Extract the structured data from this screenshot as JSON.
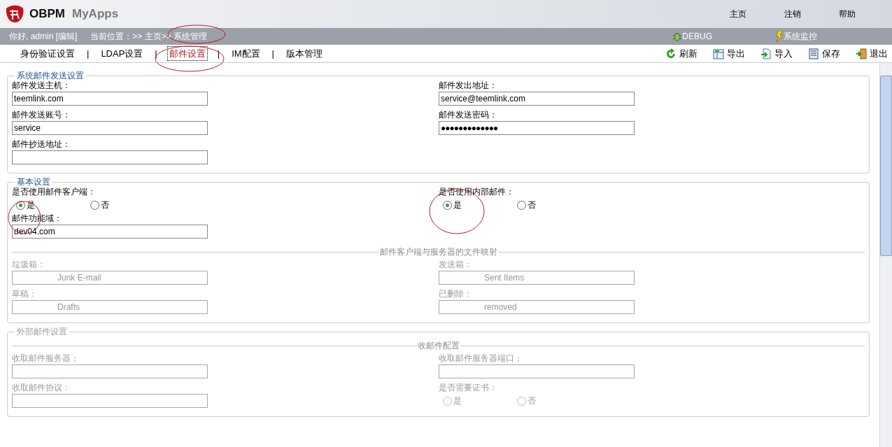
{
  "header": {
    "logo_mark": "OBPM",
    "logo_sub": "MyApps",
    "nav": [
      "主页",
      "注销",
      "帮助"
    ]
  },
  "info_bar": {
    "greeting": "你好, admin [编辑]",
    "breadcrumb": "当前位置：>> 主页>> 系统管理",
    "tools": [
      {
        "kind": "debug",
        "label": "DEBUG"
      },
      {
        "kind": "monitor",
        "label": "系统监控"
      }
    ]
  },
  "tab_separator": "|",
  "tabs": [
    {
      "label": "身份验证设置",
      "selected": false
    },
    {
      "label": "LDAP设置",
      "selected": false
    },
    {
      "label": "邮件设置",
      "selected": true
    },
    {
      "label": "IM配置",
      "selected": false
    },
    {
      "label": "版本管理",
      "selected": false
    }
  ],
  "toolbar": [
    {
      "kind": "refresh",
      "label": "刷新"
    },
    {
      "kind": "export",
      "label": "导出"
    },
    {
      "kind": "import",
      "label": "导入"
    },
    {
      "kind": "save",
      "label": "保存"
    },
    {
      "kind": "exit",
      "label": "退出"
    }
  ],
  "sections": [
    {
      "legend": "系统邮件发送设置",
      "disabled": false,
      "groups": [
        {
          "disabled": false,
          "left": [
            {
              "kind": "text",
              "label": "邮件发送主机：",
              "value": "teemlink.com"
            },
            {
              "kind": "text",
              "label": "邮件发送账号：",
              "value": "service"
            },
            {
              "kind": "text",
              "label": "邮件抄送地址："
            }
          ],
          "right": [
            {
              "kind": "text",
              "label": "邮件发出地址：",
              "value": "service@teemlink.com"
            },
            {
              "kind": "password",
              "label": "邮件发送密码：",
              "value": "●●●●●●●●●●●●●"
            }
          ]
        }
      ]
    },
    {
      "legend": "基本设置",
      "disabled": false,
      "groups": [
        {
          "disabled": false,
          "left": [
            {
              "kind": "radio",
              "label": "是否使用邮件客户端：",
              "options": [
                {
                  "label": "是",
                  "selected": true
                },
                {
                  "label": "否",
                  "selected": false
                }
              ]
            },
            {
              "kind": "text",
              "label": "邮件功能域：",
              "value": "dev04.com"
            }
          ],
          "right": [
            {
              "kind": "radio",
              "label": "是否使用内部邮件：",
              "options": [
                {
                  "label": "是",
                  "selected": true
                },
                {
                  "label": "否",
                  "selected": false
                }
              ]
            }
          ]
        },
        {
          "heading": "邮件客户端与服务器的文件映射",
          "disabled": true,
          "left": [
            {
              "kind": "text",
              "label": "垃圾箱：",
              "value": "Junk E-mail"
            },
            {
              "kind": "text",
              "label": "草稿：",
              "value": "Drafts"
            }
          ],
          "right": [
            {
              "kind": "text",
              "label": "发送箱：",
              "value": "Sent Items"
            },
            {
              "kind": "text",
              "label": "已删除：",
              "value": "removed"
            }
          ]
        }
      ]
    },
    {
      "legend": "外部邮件设置",
      "disabled": true,
      "groups": [
        {
          "heading": "收邮件配置",
          "disabled": true,
          "left": [
            {
              "kind": "text",
              "label": "收取邮件服务器："
            },
            {
              "kind": "text",
              "label": "收取邮件协议："
            }
          ],
          "right": [
            {
              "kind": "text",
              "label": "收取邮件服务器端口："
            },
            {
              "kind": "radio",
              "label": "是否需要证书：",
              "options": [
                {
                  "label": "是",
                  "selected": false
                },
                {
                  "label": "否",
                  "selected": false
                }
              ]
            }
          ]
        }
      ]
    }
  ]
}
